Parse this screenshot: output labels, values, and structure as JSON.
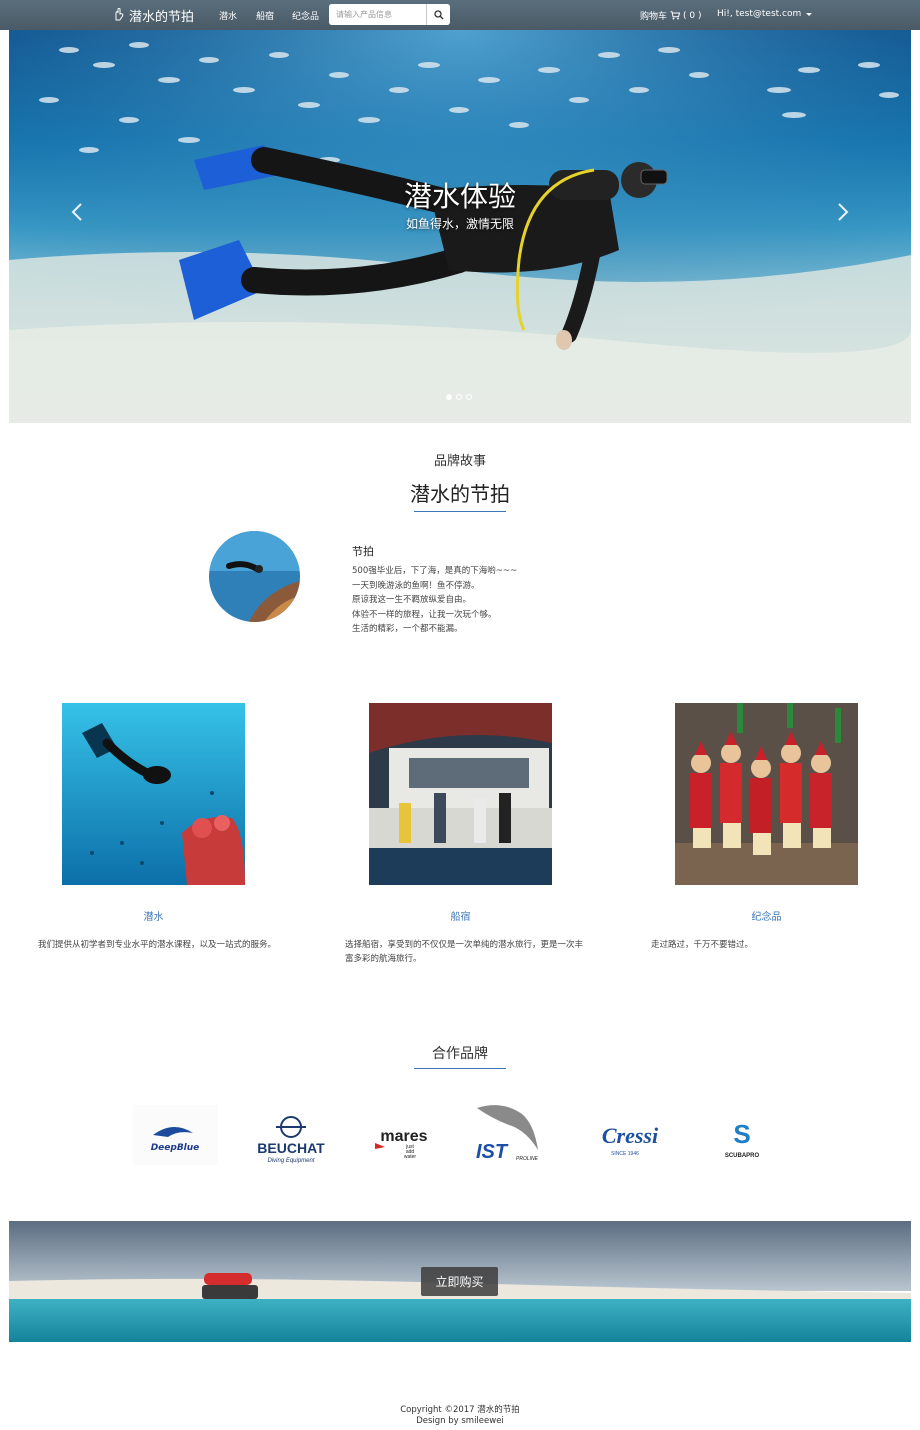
{
  "navbar": {
    "brand": "潜水的节拍",
    "links": [
      "潜水",
      "船宿",
      "纪念品"
    ],
    "search_placeholder": "请输入产品信息",
    "cart_label": "购物车",
    "cart_count": "( 0 )",
    "user_label": "Hi!, test@test.com"
  },
  "carousel": {
    "title": "潜水体验",
    "subtitle": "如鱼得水，激情无限",
    "slide_count": 3,
    "active_index": 0
  },
  "story": {
    "section_subtitle": "品牌故事",
    "section_title": "潜水的节拍",
    "title": "节拍",
    "lines": [
      "500强毕业后，下了海，是真的下海哟~~~",
      "一天到晚游泳的鱼啊！鱼不停游。",
      "原谅我这一生不羁放纵爱自由。",
      "体验不一样的旅程，让我一次玩个够。",
      "生活的精彩，一个都不能漏。"
    ]
  },
  "features": [
    {
      "title": "潜水",
      "desc": "我们提供从初学者到专业水平的潜水课程，以及一站式的服务。"
    },
    {
      "title": "船宿",
      "desc": "选择船宿，享受到的不仅仅是一次单纯的潜水旅行，更是一次丰富多彩的航海旅行。"
    },
    {
      "title": "纪念品",
      "desc": "走过路过，千万不要错过。"
    }
  ],
  "partners": {
    "title": "合作品牌",
    "brands": [
      {
        "name": "DeepBlue"
      },
      {
        "name": "BEUCHAT",
        "tagline": "Diving Equipment"
      },
      {
        "name": "mares",
        "tagline_lines": [
          "just",
          "add",
          "water"
        ]
      },
      {
        "name": "IST",
        "tagline": "PROLINE"
      },
      {
        "name": "Cressi",
        "tagline": "SINCE 1946"
      },
      {
        "name": "SCUBAPRO"
      }
    ]
  },
  "banner": {
    "button_label": "立即购买"
  },
  "footer": {
    "copyright": "Copyright ©2017 潜水的节拍",
    "design": "Design by smileewei"
  },
  "colors": {
    "accent": "#3e76b5",
    "navbar": "#52646f"
  }
}
